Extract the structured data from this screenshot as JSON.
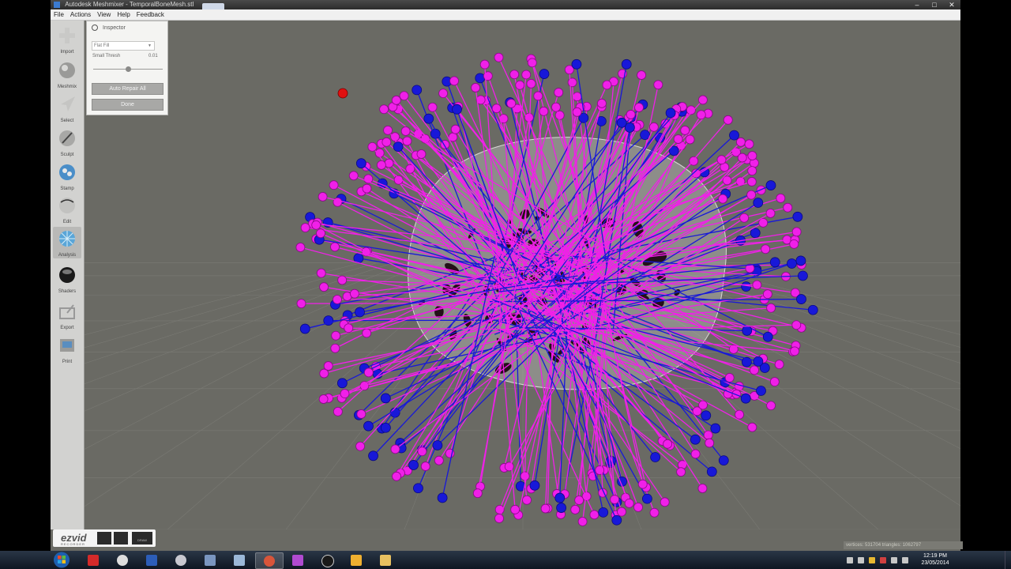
{
  "window": {
    "title": "Autodesk Meshmixer - TemporalBoneMesh.stl",
    "controls": [
      "–",
      "□",
      "✕"
    ]
  },
  "menu": [
    "File",
    "Actions",
    "View",
    "Help",
    "Feedback"
  ],
  "tools": [
    {
      "label": "Import",
      "icon": "plus-icon"
    },
    {
      "label": "Meshmix",
      "icon": "sphere-icon"
    },
    {
      "label": "Select",
      "icon": "arrow-icon"
    },
    {
      "label": "Sculpt",
      "icon": "brush-icon"
    },
    {
      "label": "Stamp",
      "icon": "stamp-icon"
    },
    {
      "label": "Edit",
      "icon": "edit-icon"
    },
    {
      "label": "Analysis",
      "icon": "analysis-icon"
    },
    {
      "label": "Shaders",
      "icon": "shader-ball-icon"
    },
    {
      "label": "Export",
      "icon": "export-icon"
    },
    {
      "label": "Print",
      "icon": "print-icon"
    }
  ],
  "inspector": {
    "title": "Inspector",
    "mode": "Flat Fill",
    "thresh_label": "Small Thresh",
    "thresh_value": "0.01",
    "thresh_level": 0.5,
    "auto_repair_label": "Auto Repair All",
    "done_label": "Done"
  },
  "status": {
    "stats": "vertices: 531704 triangles: 1062797"
  },
  "recorder": {
    "logo": "ezvid",
    "sub": "RECORDER",
    "draw": "DRAW"
  },
  "taskbar": {
    "time": "12:19 PM",
    "date": "23/05/2014"
  },
  "colors": {
    "viewport_bg": "#6a6a64",
    "issue_magenta": "#f020e8",
    "issue_blue": "#1818d8",
    "issue_red": "#e01010"
  }
}
